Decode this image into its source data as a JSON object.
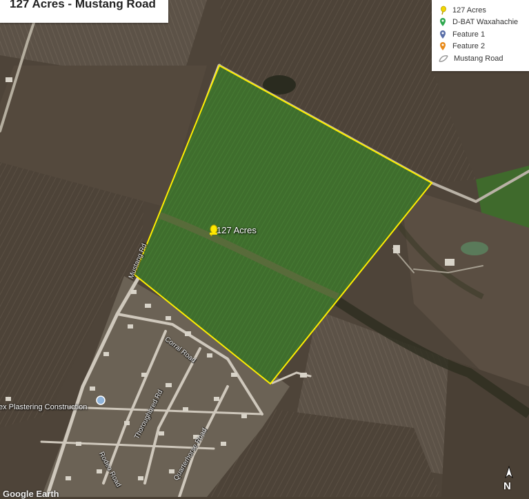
{
  "title": "127 Acres - Mustang Road",
  "legend": [
    {
      "label": "127 Acres",
      "icon": "yellow-pushpin-icon",
      "color": "#f2d600"
    },
    {
      "label": "D-BAT Waxahachie",
      "icon": "green-placemark-icon",
      "color": "#2fa84f"
    },
    {
      "label": "Feature 1",
      "icon": "blue-placemark-icon",
      "color": "#5a6fa8"
    },
    {
      "label": "Feature 2",
      "icon": "orange-placemark-icon",
      "color": "#e88a1a"
    },
    {
      "label": "Mustang Road",
      "icon": "line-path-icon",
      "color": "#bbbbbb"
    }
  ],
  "parcel": {
    "label": "127 Acres",
    "outline_color": "#ffee00"
  },
  "labels": {
    "business": "ex Plastering Construction",
    "mustang_rd": "Mustang Rd",
    "corral_road": "Corral Road",
    "thoroughbred_road": "Thoroughbred Rd",
    "quarterhorse_road": "Quarterhorse Road",
    "rodeo_road": "Rodeo Road"
  },
  "compass": "N",
  "attribution": "Google Earth"
}
